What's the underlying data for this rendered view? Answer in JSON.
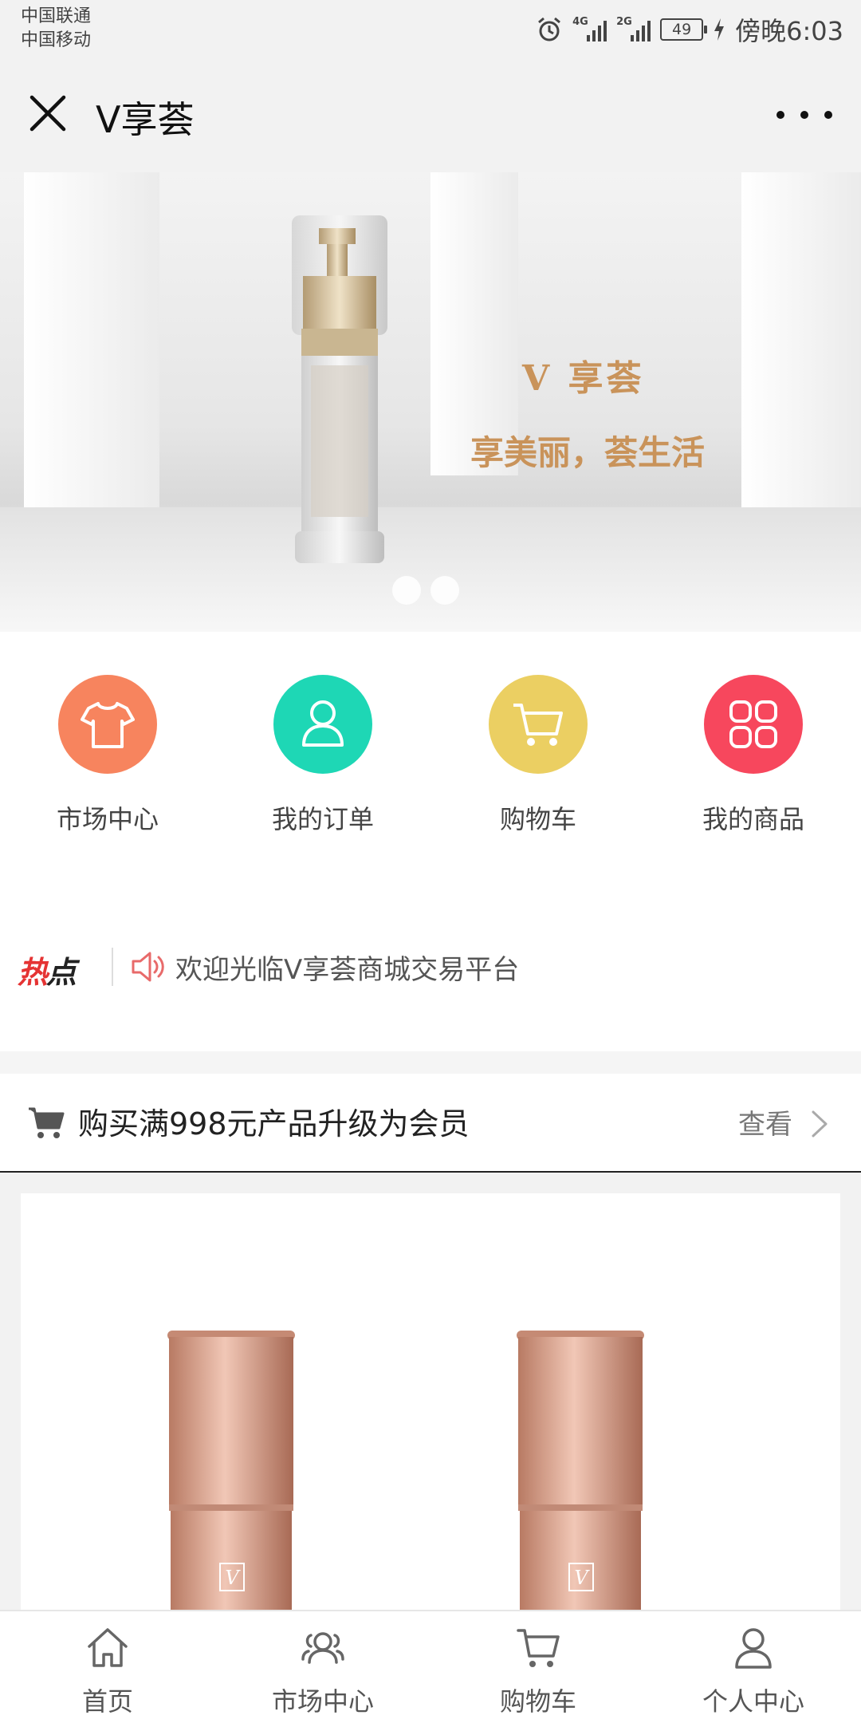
{
  "status_bar": {
    "carrier_1": "中国联通",
    "carrier_2": "中国移动",
    "net_1": "4G",
    "net_2": "2G",
    "battery": "49",
    "time": "傍晚6:03"
  },
  "header": {
    "title": "V享荟",
    "close_icon": "close-icon",
    "more_icon": "more-dots-icon"
  },
  "banner": {
    "line_1": "V 享荟",
    "line_2": "享美丽，荟生活",
    "slide_count": 2
  },
  "quick_menu": [
    {
      "label": "市场中心",
      "icon": "tshirt-icon",
      "color": "#f7845e"
    },
    {
      "label": "我的订单",
      "icon": "user-icon",
      "color": "#1ed7b5"
    },
    {
      "label": "购物车",
      "icon": "cart-icon",
      "color": "#ebcf62"
    },
    {
      "label": "我的商品",
      "icon": "grid-icon",
      "color": "#f7475d"
    }
  ],
  "hot_news": {
    "logo_1": "热",
    "logo_2": "点",
    "text": "欢迎光临V享荟商城交易平台"
  },
  "member_bar": {
    "text": "购买满998元产品升级为会员",
    "action": "查看"
  },
  "bottom_nav": [
    {
      "label": "首页",
      "icon": "home-icon"
    },
    {
      "label": "市场中心",
      "icon": "people-icon"
    },
    {
      "label": "购物车",
      "icon": "cart-icon"
    },
    {
      "label": "个人中心",
      "icon": "person-icon"
    }
  ]
}
